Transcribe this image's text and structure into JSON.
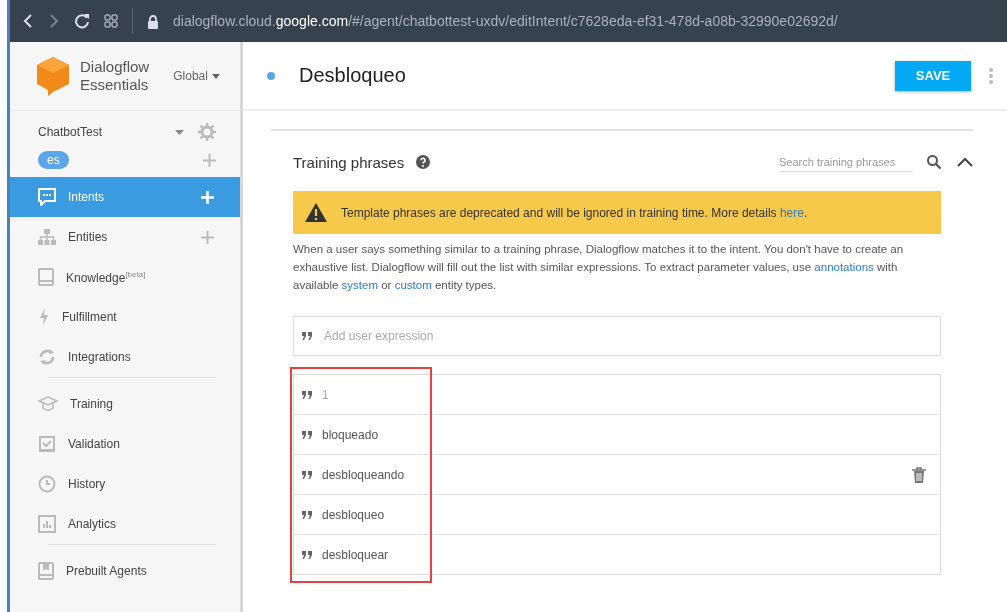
{
  "browser": {
    "url": "dialogflow.cloud.**google.com**/#/agent/chatbottest-uxdv/editIntent/c7628eda-ef31-478d-a08b-32990e02692d/"
  },
  "sidebar": {
    "product_name": "Dialogflow",
    "product_edition": "Essentials",
    "region": "Global",
    "agent": "ChatbotTest",
    "language": "es",
    "sections": [
      [
        {
          "label": "Intents",
          "selected": true,
          "addable": true
        },
        {
          "label": "Entities",
          "selected": false,
          "addable": true
        },
        {
          "label": "Knowledge$^{[beta]}$",
          "selected": false,
          "addable": false
        },
        {
          "label": "Fulfillment",
          "selected": false,
          "addable": false
        },
        {
          "label": "Integrations",
          "selected": false,
          "addable": false
        }
      ],
      [
        {
          "label": "Training",
          "selected": false,
          "addable": false
        },
        {
          "label": "Validation",
          "selected": false,
          "addable": false
        },
        {
          "label": "History",
          "selected": false,
          "addable": false
        },
        {
          "label": "Analytics",
          "selected": false,
          "addable": false
        }
      ],
      [
        {
          "label": "Prebuilt Agents",
          "selected": false,
          "addable": false
        }
      ]
    ]
  },
  "header": {
    "title": "Desbloqueo",
    "save": "SAVE"
  },
  "training": {
    "title": "Training phrases",
    "search_placeholder": "Search training phrases",
    "expanded": true,
    "warning": [
      {
        "text": "Template phrases are deprecated and will be ignored in training time. More details ",
        "link": false
      },
      {
        "text": "here",
        "link": true
      },
      {
        "text": ".",
        "link": false
      }
    ],
    "description": [
      {
        "text": "When a user says something similar to a training phrase, Dialogflow matches it to the intent. You don't have to create an exhaustive list. Dialogflow will fill out the list with similar expressions. To extract parameter values, use ",
        "link": false
      },
      {
        "text": "annotations",
        "link": true
      },
      {
        "text": " with available ",
        "link": false
      },
      {
        "text": "system",
        "link": true
      },
      {
        "text": " or ",
        "link": false
      },
      {
        "text": "custom",
        "link": true
      },
      {
        "text": " entity types.",
        "link": false
      }
    ],
    "add_placeholder": "Add user expression",
    "phrases": [
      {
        "text": "1",
        "dimmed": true,
        "hovered": false
      },
      {
        "text": "bloqueado",
        "dimmed": false,
        "hovered": false
      },
      {
        "text": "desbloqueando",
        "dimmed": false,
        "hovered": true
      },
      {
        "text": "desbloqueo",
        "dimmed": false,
        "hovered": false
      },
      {
        "text": "desbloquear",
        "dimmed": false,
        "hovered": false
      }
    ],
    "highlighted": true
  }
}
